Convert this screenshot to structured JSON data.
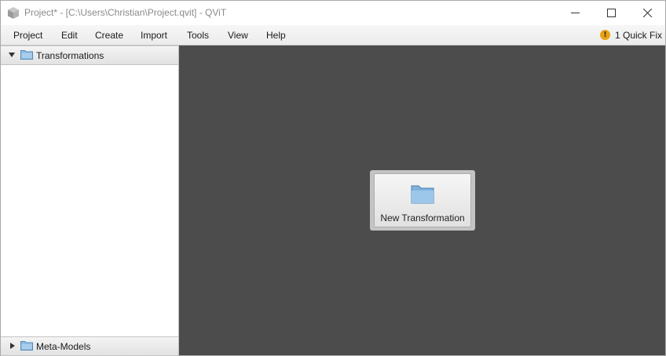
{
  "window": {
    "title": "Project* - [C:\\Users\\Christian\\Project.qvit] - QViT"
  },
  "menu": {
    "items": [
      {
        "label": "Project"
      },
      {
        "label": "Edit"
      },
      {
        "label": "Create"
      },
      {
        "label": "Import"
      },
      {
        "label": "Tools"
      },
      {
        "label": "View"
      },
      {
        "label": "Help"
      }
    ],
    "quick_fix": {
      "icon": "!",
      "label": "1 Quick Fix"
    }
  },
  "sidebar": {
    "transformations": {
      "label": "Transformations",
      "expanded": true
    },
    "meta_models": {
      "label": "Meta-Models",
      "expanded": false
    }
  },
  "main": {
    "new_transformation_label": "New Transformation"
  },
  "colors": {
    "canvas_bg": "#4c4c4c",
    "folder_blue": "#7fb2dd",
    "warning": "#e8a317"
  }
}
